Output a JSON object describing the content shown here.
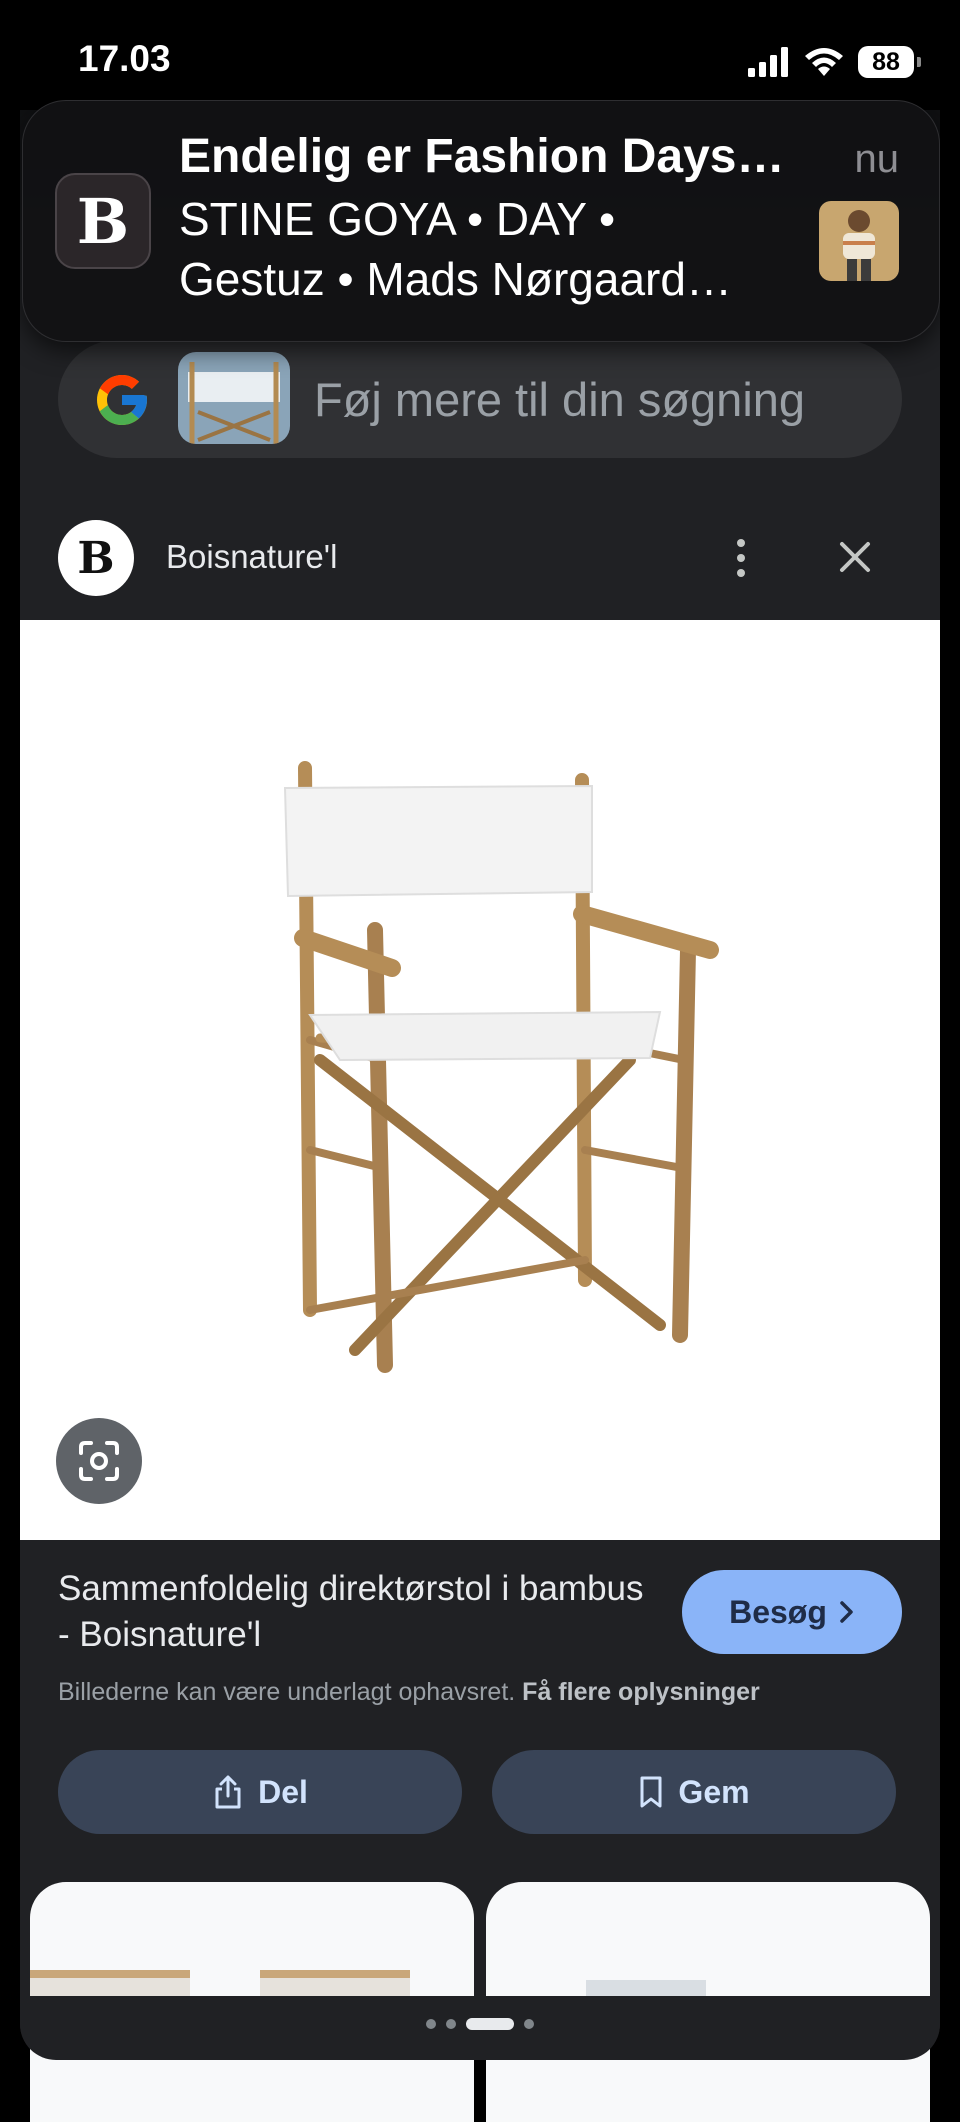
{
  "status_bar": {
    "time": "17.03",
    "battery": "88",
    "icons": [
      "signal-icon",
      "wifi-icon",
      "battery-icon"
    ]
  },
  "notification": {
    "app_letter": "B",
    "title": "Endelig er Fashion Days…",
    "time": "nu",
    "body_lines": [
      "STINE GOYA • DAY •",
      "Gestuz • Mads Nørgaard…"
    ]
  },
  "search": {
    "placeholder": "Føj mere til din søgning",
    "icon": "google-logo"
  },
  "source": {
    "avatar_letter": "B",
    "name": "Boisnature'l"
  },
  "result": {
    "title": "Sammenfoldelig direktørstol i bambus - Boisnature'l",
    "visit_label": "Besøg",
    "copyright_text": "Billederne kan være underlagt ophavsret.",
    "copyright_link": "Få flere oplysninger",
    "share_label": "Del",
    "save_label": "Gem"
  },
  "colors": {
    "accent": "#8ab4f8",
    "sheet_bg": "#202124",
    "button_bg": "#394457"
  }
}
